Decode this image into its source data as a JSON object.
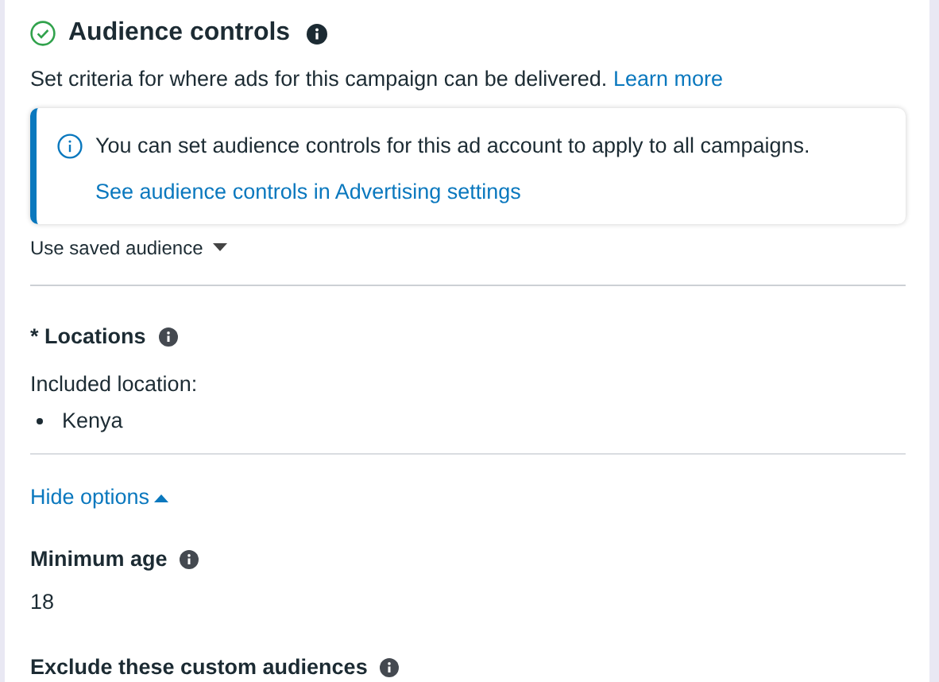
{
  "section": {
    "title": "Audience controls",
    "complete": true,
    "description": "Set criteria for where ads for this campaign can be delivered.",
    "learn_more": "Learn more"
  },
  "notice": {
    "message": "You can set audience controls for this ad account to apply to all campaigns.",
    "link": "See audience controls in Advertising settings"
  },
  "saved_audience": {
    "label": "Use saved audience",
    "expanded": false
  },
  "locations": {
    "label": "* Locations",
    "caption": "Included location:",
    "items": [
      "Kenya"
    ]
  },
  "options_toggle": {
    "label": "Hide options",
    "expanded": true
  },
  "minimum_age": {
    "label": "Minimum age",
    "value": "18"
  },
  "exclude": {
    "label": "Exclude these custom audiences"
  }
}
